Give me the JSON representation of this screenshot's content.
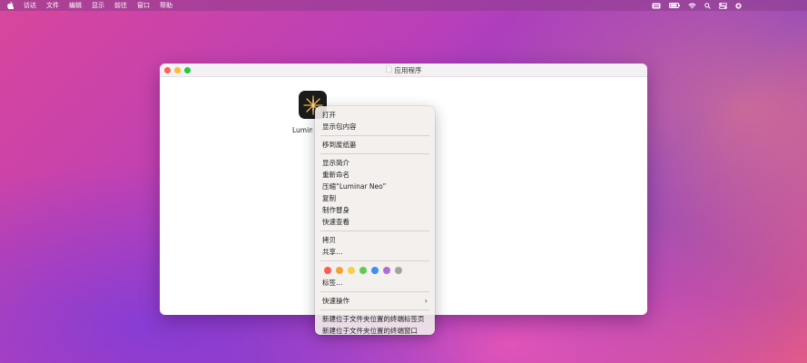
{
  "menubar": {
    "items": [
      "访达",
      "文件",
      "编辑",
      "显示",
      "前往",
      "窗口",
      "帮助"
    ]
  },
  "window": {
    "title": "应用程序",
    "app_name": "Lumina"
  },
  "context_menu": {
    "items": [
      "打开",
      "显示包内容",
      "移到废纸篓",
      "显示简介",
      "重新命名",
      "压缩“Luminar Neo”",
      "复制",
      "制作替身",
      "快速查看",
      "拷贝",
      "共享…",
      "标签…",
      "快速操作",
      "新建位于文件夹位置的终端标签页",
      "新建位于文件夹位置的终端窗口"
    ],
    "tag_colors": [
      "#ff5b52",
      "#f7a038",
      "#f6d046",
      "#5fcb4f",
      "#3d8ff2",
      "#b06bd8",
      "#a3a3a3"
    ],
    "submenu_chevron": "›"
  },
  "icons": {
    "apple": "apple-icon",
    "wifi": "wifi-icon",
    "search": "search-icon",
    "battery": "battery-icon"
  }
}
